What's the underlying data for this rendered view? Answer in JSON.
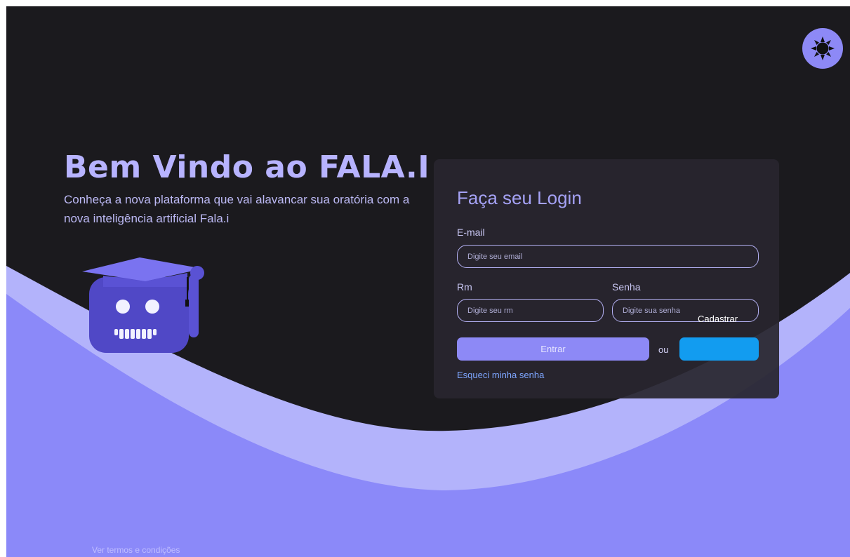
{
  "hero": {
    "title": "Bem Vindo ao FALA.I",
    "subtitle": "Conheça a nova plataforma que vai alavancar sua oratória com a nova inteligência artificial Fala.i"
  },
  "theme_toggle": {
    "icon": "sun-icon"
  },
  "login": {
    "title": "Faça seu Login",
    "email_label": "E-mail",
    "email_placeholder": "Digite seu email",
    "rm_label": "Rm",
    "rm_placeholder": "Digite seu rm",
    "password_label": "Senha",
    "password_placeholder": "Digite sua senha",
    "submit_label": "Entrar",
    "or_text": "ou",
    "register_label": "Cadastrar",
    "forgot_link": "Esqueci minha senha"
  },
  "footer": {
    "terms_link": "Ver termos e condições"
  },
  "colors": {
    "background": "#1b1a1e",
    "accent": "#8d89f6",
    "wave_light": "#b3b3fb",
    "card": "#28262e",
    "register_button": "#129cf0"
  }
}
